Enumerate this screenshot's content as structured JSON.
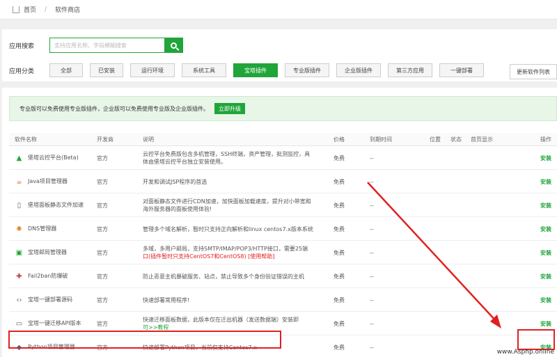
{
  "breadcrumb": {
    "home": "首页",
    "current": "软件商店"
  },
  "search": {
    "label": "应用搜索",
    "placeholder": "支持应用名称、字段模糊搜索"
  },
  "category": {
    "label": "应用分类",
    "items": [
      "全部",
      "已安装",
      "运行环境",
      "系统工具",
      "宝塔插件",
      "专业版插件",
      "企业版插件",
      "第三方应用",
      "一键部署"
    ],
    "active_index": 4
  },
  "update_button": "更新软件列表",
  "notice": {
    "text": "专业版可以免费使用专业版插件，企业版可以免费使用专业版及企业版插件。",
    "button": "立即升级"
  },
  "table": {
    "headers": [
      "软件名称",
      "开发商",
      "说明",
      "价格",
      "到期时间",
      "位置",
      "状态",
      "首页显示",
      "操作"
    ],
    "rows": [
      {
        "name": "堡塔云控平台(Beta)",
        "dev": "官方",
        "desc1": "云控平台免费版包含多机管理，SSH终端，资产管理，批测监控，具",
        "desc2": "体由堡塔云控平台独立安装使用。",
        "price": "免费",
        "exp": "--",
        "op": "安装",
        "icon": "cloud-platform-icon"
      },
      {
        "name": "Java项目管理器",
        "dev": "官方",
        "desc1": "开发和调试JSP程序的首选",
        "desc2": "",
        "price": "免费",
        "exp": "--",
        "op": "安装",
        "icon": "java-icon"
      },
      {
        "name": "堡塔面板静态文件加速",
        "dev": "官方",
        "desc1": "对面板静态文件进行CDN加速，加快面板加载速度，提升对小带宽和",
        "desc2": "海外服务器的面板使用体验!",
        "price": "免费",
        "exp": "--",
        "op": "安装",
        "icon": "static-file-icon"
      },
      {
        "name": "DNS管理器",
        "dev": "官方",
        "desc1": "管理多个域名解析，暂时只支持正向解析和linux centos7.x版本系统",
        "desc2": "",
        "price": "免费",
        "exp": "--",
        "op": "安装",
        "icon": "dns-icon"
      },
      {
        "name": "宝塔邮局管理器",
        "dev": "官方",
        "desc1": "多域，多用户邮局，支持SMTP/IMAP/POP3/HTTP接口，需要25端",
        "desc2": "口(插件暂时只支持CentOS7和CentOS8) [使用帮助]",
        "price": "免费",
        "exp": "--",
        "op": "安装",
        "icon": "mail-server-icon"
      },
      {
        "name": "Fail2ban防爆破",
        "dev": "官方",
        "desc1": "防止恶意主机暴破服务、站点，禁止导致多个身份验证错误的主机",
        "desc2": "",
        "price": "免费",
        "exp": "--",
        "op": "安装",
        "icon": "fail2ban-icon"
      },
      {
        "name": "宝塔一键部署源码",
        "dev": "官方",
        "desc1": "快速部署常用程序!",
        "desc2": "",
        "price": "免费",
        "exp": "--",
        "op": "安装",
        "icon": "code-icon"
      },
      {
        "name": "宝塔一键迁移API版本",
        "dev": "官方",
        "desc1": "快速迁移面板数据，此版本仅在迁出机器（发送数据端）安装即",
        "desc2": "可>>教程",
        "price": "免费",
        "exp": "--",
        "op": "安装",
        "icon": "migrate-icon"
      },
      {
        "name": "Python项目管理器",
        "dev": "官方",
        "desc1": "快速部署Python项目，当前仅支持Centos7.x",
        "desc2": "",
        "price": "免费",
        "exp": "--",
        "op": "安装",
        "icon": "python-icon"
      }
    ]
  },
  "watermark": "www.Asphp.online",
  "colors": {
    "accent": "#20a53a",
    "highlight": "#e02020"
  }
}
